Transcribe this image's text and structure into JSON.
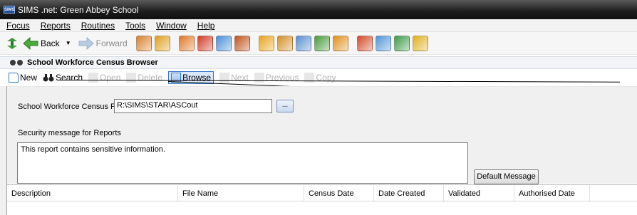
{
  "window": {
    "title": "SIMS .net: Green Abbey School",
    "app_icon_text": "SIMS"
  },
  "menu": [
    "Focus",
    "Reports",
    "Routines",
    "Tools",
    "Window",
    "Help"
  ],
  "nav": {
    "back_label": "Back",
    "forward_label": "Forward"
  },
  "toolbar_icons": [
    {
      "name": "people-icon",
      "color": "#d9822b"
    },
    {
      "name": "person-icon",
      "color": "#e0a020"
    },
    {
      "name": "folder-icon",
      "color": "#e0782a"
    },
    {
      "name": "flag-icon",
      "color": "#d23d2a"
    },
    {
      "name": "contacts-icon",
      "color": "#4a8fd6"
    },
    {
      "name": "portrait-icon",
      "color": "#c0531e"
    },
    {
      "name": "book-icon",
      "color": "#e8a41c"
    },
    {
      "name": "student-book-icon",
      "color": "#d4902a"
    },
    {
      "name": "register-icon",
      "color": "#5a8fd0"
    },
    {
      "name": "edit-icon",
      "color": "#4a9a3c"
    },
    {
      "name": "learner-icon",
      "color": "#e09020"
    },
    {
      "name": "clock-icon",
      "color": "#d44a2a"
    },
    {
      "name": "photo-icon",
      "color": "#4f95d6"
    },
    {
      "name": "swap-icon",
      "color": "#3e9a4a"
    },
    {
      "name": "export-icon",
      "color": "#e0b020"
    }
  ],
  "panel": {
    "title": "School Workforce Census Browser"
  },
  "subtoolbar": {
    "new_label": "New",
    "search_label": "Search",
    "open_label": "Open",
    "delete_label": "Delete",
    "browse_label": "Browse",
    "next_label": "Next",
    "previous_label": "Previous",
    "copy_label": "Copy"
  },
  "form": {
    "folder_label": "School Workforce Census Folder",
    "folder_value": "R:\\SIMS\\STAR\\ASCout",
    "browse_button": "...",
    "security_label": "Security message for Reports",
    "security_value": "This report contains sensitive information.",
    "default_button": "Default Message"
  },
  "grid": {
    "columns": [
      "Description",
      "File Name",
      "Census Date",
      "Date Created",
      "Validated",
      "Authorised Date"
    ]
  }
}
